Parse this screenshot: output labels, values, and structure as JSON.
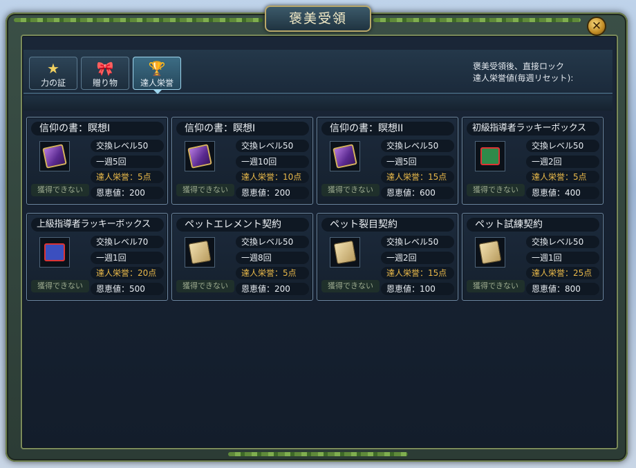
{
  "window": {
    "title": "褒美受領",
    "close_glyph": "✕"
  },
  "tabs": [
    {
      "label": "力の証",
      "icon": "star-icon",
      "active": false
    },
    {
      "label": "贈り物",
      "icon": "gift-bow-icon",
      "active": false
    },
    {
      "label": "達人栄誉",
      "icon": "honor-trophy-icon",
      "active": true
    }
  ],
  "info": {
    "line1": "褒美受領後、直接ロック",
    "line2": "達人栄誉値(毎週リセット):"
  },
  "cards": [
    {
      "title": "信仰の書：瞑想I",
      "icon": "purple-book-icon",
      "exchange_level": "交換レベル50",
      "weekly": "一週5回",
      "honor": "達人栄誉：5点",
      "favor": "恩恵値：200",
      "status": "獲得できない"
    },
    {
      "title": "信仰の書：瞑想I",
      "icon": "purple-book-icon",
      "exchange_level": "交換レベル50",
      "weekly": "一週10回",
      "honor": "達人栄誉：10点",
      "favor": "恩恵値：200",
      "status": "獲得できない"
    },
    {
      "title": "信仰の書：瞑想II",
      "icon": "purple-book-icon",
      "exchange_level": "交換レベル50",
      "weekly": "一週5回",
      "honor": "達人栄誉：15点",
      "favor": "恩恵値：600",
      "status": "獲得できない"
    },
    {
      "title": "初級指導者ラッキーボックス",
      "icon": "green-gift-box-icon",
      "exchange_level": "交換レベル50",
      "weekly": "一週2回",
      "honor": "達人栄誉：5点",
      "favor": "恩恵値：400",
      "status": "獲得できない"
    },
    {
      "title": "上級指導者ラッキーボックス",
      "icon": "blue-gift-box-icon",
      "exchange_level": "交換レベル70",
      "weekly": "一週1回",
      "honor": "達人栄誉：20点",
      "favor": "恩恵値：500",
      "status": "獲得できない"
    },
    {
      "title": "ペットエレメント契約",
      "icon": "contract-scroll-icon",
      "exchange_level": "交換レベル50",
      "weekly": "一週8回",
      "honor": "達人栄誉：5点",
      "favor": "恩恵値：200",
      "status": "獲得できない"
    },
    {
      "title": "ペット裂目契約",
      "icon": "contract-scroll-icon",
      "exchange_level": "交換レベル50",
      "weekly": "一週2回",
      "honor": "達人栄誉：15点",
      "favor": "恩恵値：100",
      "status": "獲得できない"
    },
    {
      "title": "ペット試練契約",
      "icon": "contract-scroll-icon",
      "exchange_level": "交換レベル50",
      "weekly": "一週1回",
      "honor": "達人栄誉：25点",
      "favor": "恩恵値：800",
      "status": "獲得できない"
    }
  ]
}
